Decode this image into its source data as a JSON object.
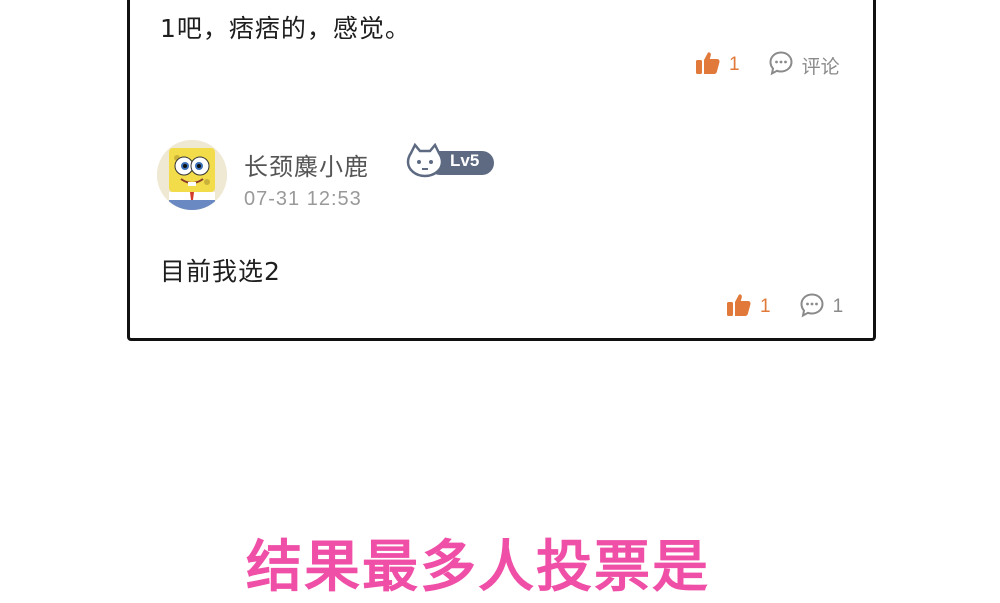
{
  "colors": {
    "accent_orange": "#e0793a",
    "border": "#111111",
    "caption_pink": "#ef4fa6",
    "muted_gray": "#8a8a8a",
    "badge_bg": "#5d6a82"
  },
  "previous_comment": {
    "text": "1吧，痞痞的，感觉。",
    "likes": "1",
    "comment_label": "评论",
    "like_icon": "thumbs-up-icon",
    "comment_icon": "speech-bubble-icon"
  },
  "comment": {
    "username": "长颈麋小鹿",
    "level": "Lv5",
    "timestamp": "07-31 12:53",
    "text": "目前我选2",
    "likes": "1",
    "comments": "1",
    "avatar_icon": "spongebob-avatar"
  },
  "caption": "结果最多人投票是"
}
